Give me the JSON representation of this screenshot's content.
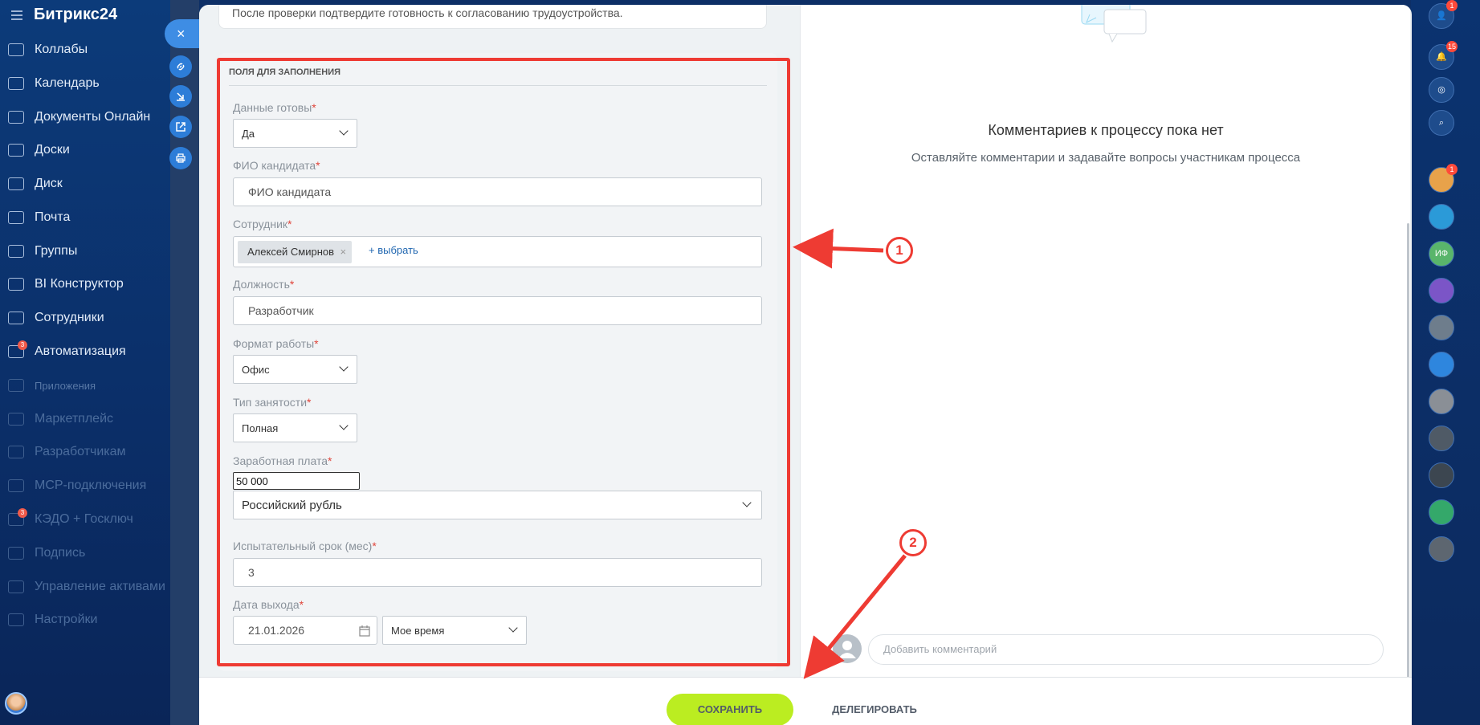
{
  "app": {
    "logo": "Битрикс24"
  },
  "sidebar": {
    "items": [
      {
        "label": "Коллабы",
        "icon": "collab-icon"
      },
      {
        "label": "Календарь",
        "icon": "calendar-icon"
      },
      {
        "label": "Документы Онлайн",
        "icon": "documents-icon"
      },
      {
        "label": "Доски",
        "icon": "boards-icon"
      },
      {
        "label": "Диск",
        "icon": "disk-icon"
      },
      {
        "label": "Почта",
        "icon": "mail-icon"
      },
      {
        "label": "Группы",
        "icon": "groups-icon"
      },
      {
        "label": "BI Конструктор",
        "icon": "bi-icon"
      },
      {
        "label": "Сотрудники",
        "icon": "employees-icon"
      },
      {
        "label": "Автоматизация",
        "icon": "automation-icon",
        "badge": "3"
      },
      {
        "label": "Приложения",
        "icon": "apps-icon"
      },
      {
        "label": "Маркетплейс",
        "icon": "marketplace-icon"
      },
      {
        "label": "Разработчикам",
        "icon": "developers-icon"
      },
      {
        "label": "MCP-подключения",
        "icon": "mcp-icon"
      },
      {
        "label": "КЭДО + Госключ",
        "icon": "kedo-icon",
        "badge": "3"
      },
      {
        "label": "Подпись",
        "icon": "sign-icon"
      },
      {
        "label": "Управление активами",
        "icon": "assets-icon"
      },
      {
        "label": "Настройки",
        "icon": "settings-icon"
      }
    ]
  },
  "tools": {
    "close": "×",
    "link": "link-icon",
    "download": "download-icon",
    "open": "open-icon",
    "print": "print-icon"
  },
  "form": {
    "top_note": "После проверки подтвердите готовность к согласованию трудоустройства.",
    "section_title": "Поля для заполнения",
    "required_mark": "*",
    "fields": {
      "ready": {
        "label": "Данные готовы",
        "value": "Да"
      },
      "candidate": {
        "label": "ФИО кандидата",
        "placeholder": "ФИО кандидата"
      },
      "employee": {
        "label": "Сотрудник",
        "tag": "Алексей Смирнов",
        "tag_remove": "×",
        "pick": "+ выбрать"
      },
      "position": {
        "label": "Должность",
        "value": "Разработчик"
      },
      "format": {
        "label": "Формат работы",
        "value": "Офис"
      },
      "employment": {
        "label": "Тип занятости",
        "value": "Полная"
      },
      "salary": {
        "label": "Заработная плата",
        "value": "50 000",
        "currency": "Российский рубль"
      },
      "probation": {
        "label": "Испытательный срок (мес)",
        "value": "3"
      },
      "start": {
        "label": "Дата выхода",
        "date": "21.01.2026",
        "timezone": "Мое время"
      }
    }
  },
  "comments": {
    "empty_title": "Комментариев к процессу пока нет",
    "empty_subtitle": "Оставляйте комментарии и задавайте вопросы участникам процесса",
    "input_placeholder": "Добавить комментарий"
  },
  "footer": {
    "save": "СОХРАНИТЬ",
    "delegate": "ДЕЛЕГИРОВАТЬ"
  },
  "annotations": {
    "marker1": "1",
    "marker2": "2",
    "color": "#ee3b33"
  },
  "rightbar": {
    "profile_badge": "1",
    "notifications_badge": "15",
    "chat_badge": "1",
    "initials": "ИФ"
  }
}
